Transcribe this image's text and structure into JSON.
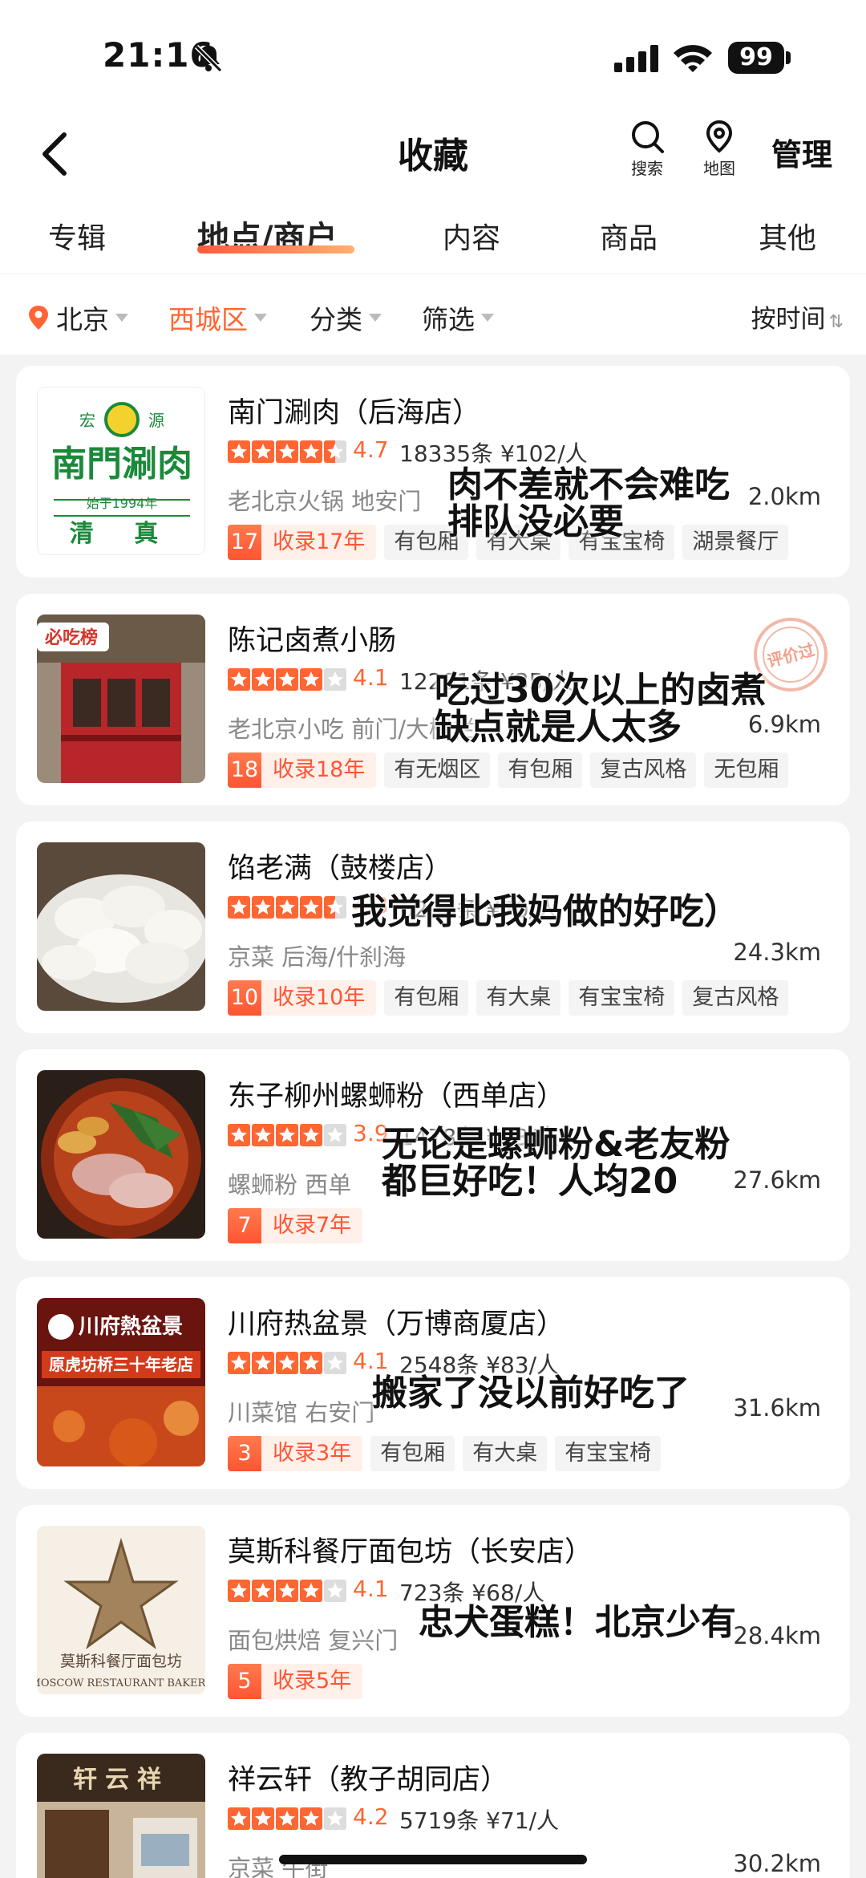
{
  "status_bar": {
    "time": "21:16",
    "battery": "99"
  },
  "nav": {
    "title": "收藏",
    "search_label": "搜索",
    "map_label": "地图",
    "manage_label": "管理"
  },
  "tabs": [
    {
      "label": "专辑"
    },
    {
      "label": "地点/商户",
      "active": true
    },
    {
      "label": "内容"
    },
    {
      "label": "商品"
    },
    {
      "label": "其他"
    }
  ],
  "filters": {
    "city": "北京",
    "district": "西城区",
    "category": "分类",
    "filter": "筛选",
    "sort": "按时间",
    "sort_icon": "⇅"
  },
  "shops": [
    {
      "name": "南门涮肉（后海店）",
      "rating": 4.7,
      "score": "4.7",
      "reviews": "18335条 ¥102/人",
      "category": "老北京火锅 地安门",
      "distance": "2.0km",
      "collect_num": "17",
      "collect_text": "收录17年",
      "tags": [
        "有包厢",
        "有大桌",
        "有宝宝椅",
        "湖景餐厅"
      ],
      "note": "肉不差就不会难吃\n排队没必要",
      "thumb": "thumb-nanmen",
      "thumb_text": {
        "brand": "宏源",
        "name": "南門涮肉",
        "since": "始于1994年",
        "halal": "清真"
      }
    },
    {
      "name": "陈记卤煮小肠",
      "rating": 4.1,
      "score": "4.1",
      "reviews": "12201条 ¥35/人",
      "category": "老北京小吃 前门/大栅栏",
      "distance": "6.9km",
      "collect_num": "18",
      "collect_text": "收录18年",
      "tags": [
        "有无烟区",
        "有包厢",
        "复古风格",
        "无包厢"
      ],
      "note": "吃过30次以上的卤煮\n缺点就是人太多",
      "thumb": "thumb-chenji",
      "stamp": "评价过",
      "thumb_text": {
        "badge": "必吃榜"
      }
    },
    {
      "name": "馅老满（鼓楼店）",
      "rating": 4.3,
      "score": "4.3",
      "reviews": "6294条 ¥70/人",
      "category": "京菜 后海/什刹海",
      "distance": "24.3km",
      "collect_num": "10",
      "collect_text": "收录10年",
      "tags": [
        "有包厢",
        "有大桌",
        "有宝宝椅",
        "复古风格"
      ],
      "note": "我觉得比我妈做的好吃）",
      "thumb": "thumb-dumplings"
    },
    {
      "name": "东子柳州螺蛳粉（西单店）",
      "rating": 3.9,
      "score": "3.9",
      "reviews": "1478条 ¥23/人",
      "category": "螺蛳粉 西单",
      "distance": "27.6km",
      "collect_num": "7",
      "collect_text": "收录7年",
      "tags": [],
      "note": "无论是螺蛳粉&老友粉\n都巨好吃！人均20",
      "thumb": "thumb-luosifen"
    },
    {
      "name": "川府热盆景（万博商厦店）",
      "rating": 4.1,
      "score": "4.1",
      "reviews": "2548条 ¥83/人",
      "category": "川菜馆 右安门",
      "distance": "31.6km",
      "collect_num": "3",
      "collect_text": "收录3年",
      "tags": [
        "有包厢",
        "有大桌",
        "有宝宝椅"
      ],
      "note": "搬家了没以前好吃了",
      "thumb": "thumb-chuanfu",
      "thumb_text": {
        "logo": "川府熱盆景",
        "banner": "原虎坊桥三十年老店"
      }
    },
    {
      "name": "莫斯科餐厅面包坊（长安店）",
      "rating": 4.1,
      "score": "4.1",
      "reviews": "723条 ¥68/人",
      "category": "面包烘焙 复兴门",
      "distance": "28.4km",
      "collect_num": "5",
      "collect_text": "收录5年",
      "tags": [],
      "note": "忠犬蛋糕！北京少有",
      "thumb": "thumb-moscow",
      "thumb_text": {
        "cn": "莫斯科餐厅面包坊",
        "en": "MOSCOW RESTAURANT BAKERY"
      }
    },
    {
      "name": "祥云轩（教子胡同店）",
      "rating": 4.2,
      "score": "4.2",
      "reviews": "5719条 ¥71/人",
      "category": "京菜 牛街",
      "distance": "30.2km",
      "collect_num": "",
      "collect_text": "",
      "tags": [],
      "note": "",
      "thumb": "thumb-xiangyun",
      "thumb_text": {
        "sign": "轩云祥"
      }
    }
  ]
}
